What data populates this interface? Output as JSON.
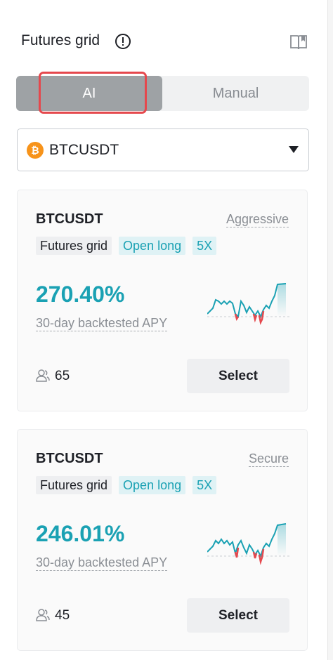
{
  "header": {
    "title": "Futures grid",
    "info_icon": "info-circle-icon",
    "guide_icon": "book-icon"
  },
  "mode_toggle": {
    "ai_label": "AI",
    "manual_label": "Manual",
    "selected": "AI"
  },
  "symbol_select": {
    "value": "BTCUSDT",
    "icon": "bitcoin-icon",
    "dropdown_icon": "caret-down-icon"
  },
  "colors": {
    "accent_teal": "#1aa1b3",
    "loss_red": "#e5484d",
    "highlight_red": "#e5484d"
  },
  "cards": [
    {
      "symbol": "BTCUSDT",
      "risk": "Aggressive",
      "tags": [
        "Futures grid",
        "Open long",
        "5X"
      ],
      "apy_value": "270.40%",
      "apy_label": "30-day backtested APY",
      "users": "65",
      "select_label": "Select"
    },
    {
      "symbol": "BTCUSDT",
      "risk": "Secure",
      "tags": [
        "Futures grid",
        "Open long",
        "5X"
      ],
      "apy_value": "246.01%",
      "apy_label": "30-day backtested APY",
      "users": "45",
      "select_label": "Select"
    }
  ]
}
